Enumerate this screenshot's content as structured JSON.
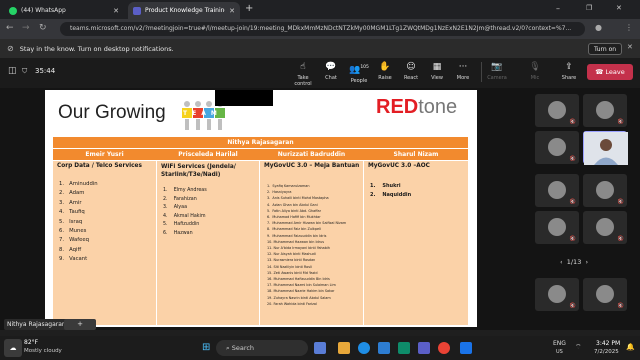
{
  "browser": {
    "tabs": [
      {
        "label": "(44) WhatsApp",
        "active": false
      },
      {
        "label": "Product Knowledge Training",
        "active": true
      }
    ],
    "new_tab": "+",
    "window_controls": [
      "–",
      "❐",
      "✕"
    ],
    "url": "teams.microsoft.com/v2/?meetingjoin=true#/l/meetup-join/19:meeting_MDkxMmMzNDctNTZkMy00MGM1LTg1ZWQtMDg1NzExN2E1N2Jm@thread.v2/0?context=%7..."
  },
  "notification": {
    "text": "Stay in the know. Turn on desktop notifications.",
    "button": "Turn on"
  },
  "meeting": {
    "timer": "35:44",
    "controls": [
      {
        "label": "Take control",
        "icon": "pointer-icon"
      },
      {
        "label": "Chat",
        "icon": "chat-icon"
      },
      {
        "label": "People",
        "icon": "people-icon",
        "badge": "105"
      },
      {
        "label": "Raise",
        "icon": "hand-icon"
      },
      {
        "label": "React",
        "icon": "smile-icon"
      },
      {
        "label": "View",
        "icon": "grid-icon"
      },
      {
        "label": "More",
        "icon": "more-icon"
      },
      {
        "label": "Camera",
        "icon": "camera-icon"
      },
      {
        "label": "Mic",
        "icon": "mic-icon"
      },
      {
        "label": "Share",
        "icon": "share-icon"
      }
    ],
    "leave": "Leave",
    "pager": "1/13",
    "presenter_name": "Nithya Rajasagaran"
  },
  "slide": {
    "title": "Our Growing",
    "team_word": "TEAM",
    "brand_red": "RED",
    "brand_gray": "tone",
    "lead": "Nithya Rajasagaran",
    "columns": [
      {
        "header": "Emeir Yusri",
        "group": "Corp Data / Telco Services",
        "members": [
          "Aminuddin",
          "Adam",
          "Amir",
          "Taufiq",
          "Israq",
          "Munes",
          "Wafeeq",
          "Aqiff",
          "Vacant"
        ]
      },
      {
        "header": "Prisceleda Harilal",
        "group": "WiFi Services (Jendela/ Starlink/T3e/Nadi)",
        "members": [
          "Elmy Andreas",
          "Farahizan",
          "Alyaa",
          "Akmal Hakim",
          "Hafizuddin",
          "Hazwan"
        ]
      },
      {
        "header": "Nurizzati Badruddin",
        "group": "MyGovUC 3.0 – Meja Bantuan",
        "members": [
          "Syafiq Kamarulzaman",
          "Hasniyayra",
          "Anis Suhaili binti Mohd Mostapha",
          "Azlan Ghan bin Abdul Gani",
          "Fatin Aliya binti Abd. Ghaffar",
          "Muhamad Hafifi bin Mukhtar",
          "Muhammad Amir Hizwan bin Saifizal Nizam",
          "Muhammad Faiz bin Zulkpeli",
          "Muhammad Faizuuddin bin Idris",
          "Muhammad Hazwan bin Idrus",
          "Nur A'bida Irmayani binti Yahabih",
          "Nur Aisyah binti Mashudi",
          "Nurasmiera binti Rosdan",
          "Siti Nazliiyin binti Rosli",
          "Zeti Awanis binti Md Yazid",
          "Muhammad Hafizuuddin Bin Idris",
          "Muhammad Nazmi bin Sulaiman Lim",
          "Muhammad Nazrie Hakim bin Sakar",
          "Zuhayra Nasrin binti Abdul Salam",
          "Farah Wahida binti Farizal"
        ]
      },
      {
        "header": "Sharul Nizam",
        "group": "MyGovUC 3.0 –AOC",
        "members": [
          "Shukri",
          "Naquiddin"
        ]
      }
    ]
  },
  "taskbar": {
    "weather_temp": "82°F",
    "weather_desc": "Mostly cloudy",
    "search": "Search",
    "lang": "ENG",
    "region": "US",
    "time": "3:42 PM",
    "date": "7/2/2025"
  },
  "colors": {
    "orange": "#f28a2e",
    "light_orange": "#fbd2a8",
    "red": "#e31e24",
    "leave": "#c4314b"
  }
}
